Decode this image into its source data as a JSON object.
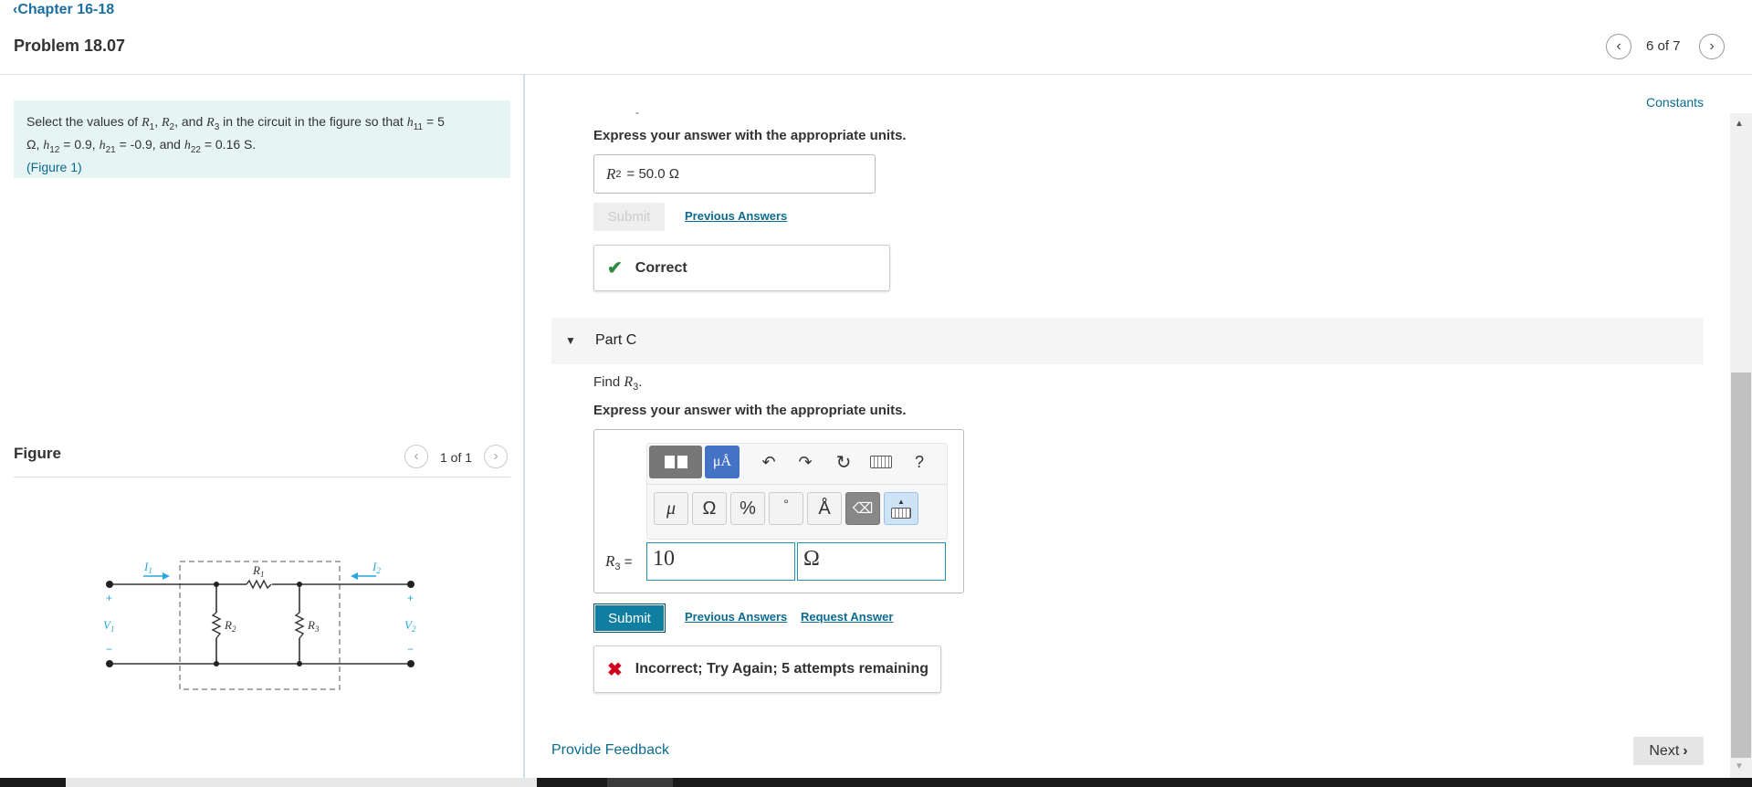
{
  "header": {
    "back_label": "Chapter 16-18",
    "problem_title": "Problem 18.07",
    "pager": "6 of 7",
    "constants_link": "Constants"
  },
  "prompt": {
    "text_a": "Select the values of",
    "r1": "R",
    "r1_sub": "1",
    "sep1": ",",
    "r2": "R",
    "r2_sub": "2",
    "sep2": ", and",
    "r3": "R",
    "r3_sub": "3",
    "text_b": "in the circuit in the figure so that",
    "h11": "h",
    "h11_sub": "11",
    "h11_val": "= 5",
    "ohm": "Ω",
    "sep3": ",",
    "h12": "h",
    "h12_sub": "12",
    "h12_val": "= 0.9,",
    "h21": "h",
    "h21_sub": "21",
    "h21_val": "= -0.9, and",
    "h22": "h",
    "h22_sub": "22",
    "h22_val": "= 0.16",
    "siemens": "S",
    "period": ".",
    "figure_link": "(Figure 1)"
  },
  "figure": {
    "heading": "Figure",
    "pager": "1 of 1",
    "labels": {
      "i1": "I",
      "i1_sub": "1",
      "i2": "I",
      "i2_sub": "2",
      "r1": "R",
      "r1_sub": "1",
      "r2": "R",
      "r2_sub": "2",
      "r3": "R",
      "r3_sub": "3",
      "v1": "V",
      "v1_sub": "1",
      "v2": "V",
      "v2_sub": "2",
      "plus": "+",
      "minus": "−"
    }
  },
  "part_b": {
    "dash": "-",
    "instruction": "Express your answer with the appropriate units.",
    "answer_var": "R",
    "answer_sub": "2",
    "answer_value": "=  50.0 Ω",
    "submit_label": "Submit",
    "previous_answers": "Previous Answers",
    "feedback": "Correct"
  },
  "part_c": {
    "title": "Part C",
    "find_text": "Find",
    "find_var": "R",
    "find_sub": "3",
    "find_period": ".",
    "instruction": "Express your answer with the appropriate units.",
    "answer_var": "R",
    "answer_sub": "3",
    "answer_eq": "=",
    "value_input": "10",
    "unit_input": "Ω",
    "toolbar": {
      "units_label": "μÅ",
      "help": "?"
    },
    "symbols": [
      "μ",
      "Ω",
      "%",
      "°",
      "Å"
    ],
    "submit_label": "Submit",
    "previous_answers": "Previous Answers",
    "request_answer": "Request Answer",
    "feedback": "Incorrect; Try Again; 5 attempts remaining"
  },
  "footer": {
    "provide_feedback": "Provide Feedback",
    "next_label": "Next"
  },
  "colors": {
    "accent": "#0f7ea0",
    "link": "#0b6b8f",
    "correct": "#2e8b3d",
    "incorrect": "#d0021b",
    "prompt_bg": "#e6f4f4",
    "figure_blue": "#29a9e0"
  }
}
